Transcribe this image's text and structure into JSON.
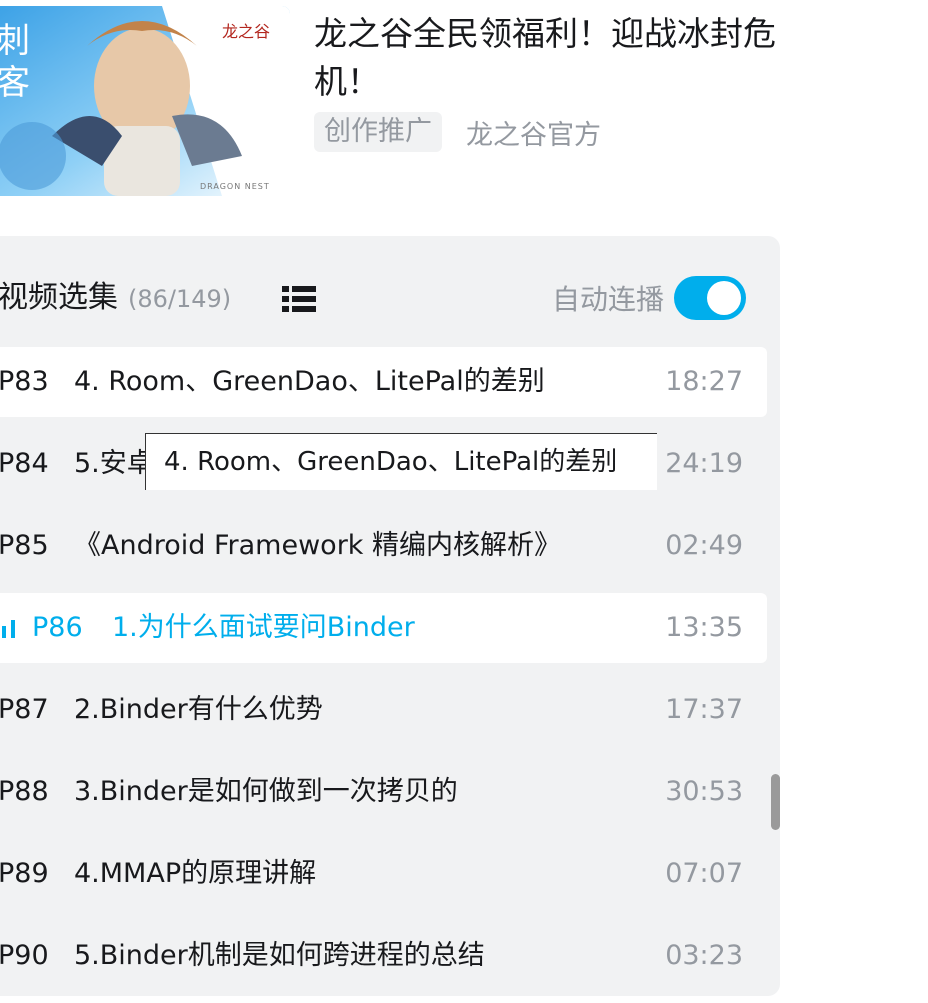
{
  "ad": {
    "thumb_side_text": "刺客",
    "thumb_logo": "龙之谷",
    "thumb_caption": "DRAGON NEST",
    "title": "龙之谷全民领福利！迎战冰封危机！",
    "tag": "创作推广",
    "uploader": "龙之谷官方"
  },
  "episodes_panel": {
    "title": "视频选集",
    "count": "(86/149)",
    "list_icon": "list-icon",
    "autoplay_label": "自动连播",
    "autoplay_on": true,
    "accent_color": "#00aeec",
    "episodes": [
      {
        "index": "P83",
        "title": "4. Room、GreenDao、LitePal的差别",
        "duration": "18:27",
        "state": "hover"
      },
      {
        "index": "P84",
        "title": "5.安卓",
        "duration": "24:19",
        "state": "normal"
      },
      {
        "index": "P85",
        "title": "《Android Framework 精编内核解析》",
        "duration": "02:49",
        "state": "normal"
      },
      {
        "index": "P86",
        "title": "1.为什么面试要问Binder",
        "duration": "13:35",
        "state": "active"
      },
      {
        "index": "P87",
        "title": "2.Binder有什么优势",
        "duration": "17:37",
        "state": "normal"
      },
      {
        "index": "P88",
        "title": "3.Binder是如何做到一次拷贝的",
        "duration": "30:53",
        "state": "normal"
      },
      {
        "index": "P89",
        "title": "4.MMAP的原理讲解",
        "duration": "07:07",
        "state": "normal"
      },
      {
        "index": "P90",
        "title": "5.Binder机制是如何跨进程的总结",
        "duration": "03:23",
        "state": "normal"
      }
    ],
    "tooltip": "4. Room、GreenDao、LitePal的差别"
  }
}
